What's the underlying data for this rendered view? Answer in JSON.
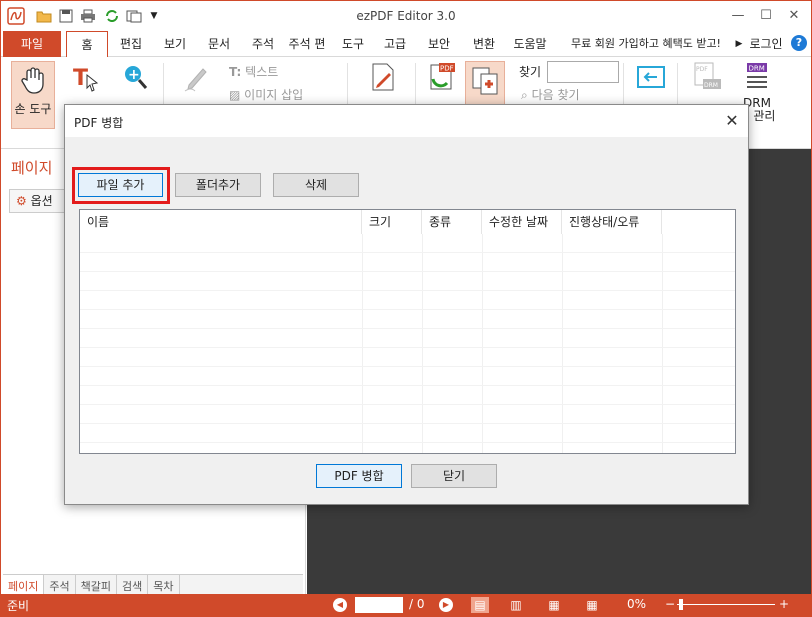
{
  "app": {
    "title": "ezPDF Editor 3.0"
  },
  "tabs": {
    "file": "파일",
    "items": [
      "홈",
      "편집",
      "보기",
      "문서",
      "주석",
      "주석 편",
      "도구",
      "고급",
      "보안",
      "변환",
      "도움말",
      "무료 회원 가입하고 혜택도 받고!",
      "로그인"
    ]
  },
  "ribbon": {
    "hand_tool": "손 도구",
    "text": "텍스트",
    "image_insert": "이미지 삽입",
    "find_label": "찾기",
    "find_next": "다음 찾기",
    "drm_label": "DRM",
    "drm_manage": "책 관리"
  },
  "left_panel": {
    "title": "페이지",
    "options": "옵션",
    "tabs": [
      "페이지",
      "주석",
      "책갈피",
      "검색",
      "목차"
    ]
  },
  "status": {
    "ready": "준비",
    "page_total": "/ 0",
    "zoom": "0%"
  },
  "dialog": {
    "title": "PDF 병합",
    "add_file": "파일 추가",
    "add_folder": "폴더추가",
    "delete": "삭제",
    "columns": [
      "이름",
      "크기",
      "종류",
      "수정한 날짜",
      "진행상태/오류"
    ],
    "merge": "PDF 병합",
    "close": "닫기"
  },
  "colors": {
    "accent": "#d04a2a",
    "highlight": "#e31b1b",
    "doc_bg": "#3a3a3a"
  }
}
